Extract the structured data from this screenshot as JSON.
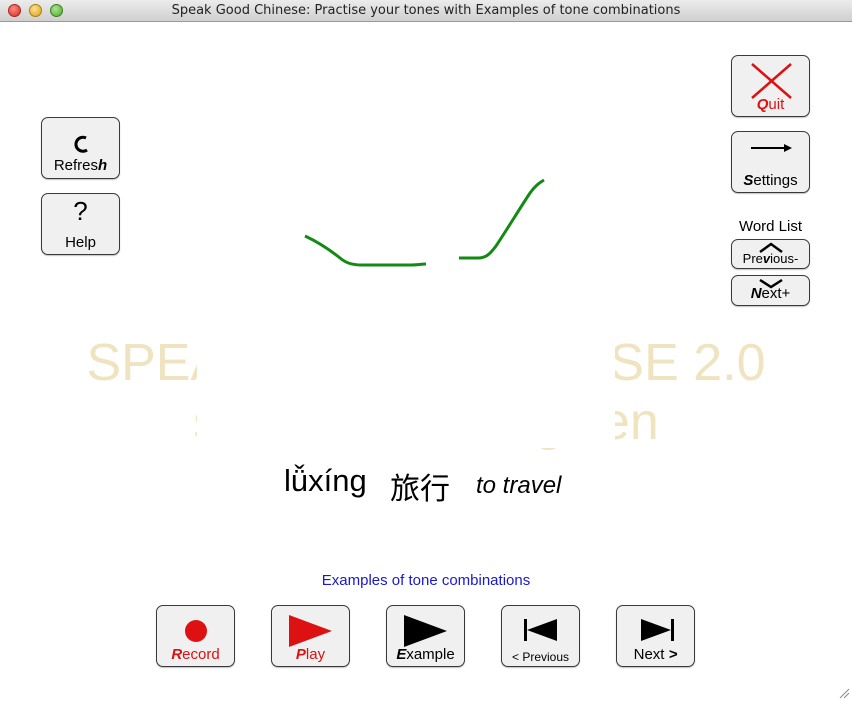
{
  "window": {
    "title": "Speak Good Chinese: Practise your tones with Examples of tone combinations"
  },
  "left_buttons": {
    "refresh": "Refresh",
    "help_symbol": "?",
    "help": "Help"
  },
  "right_buttons": {
    "quit": "Quit",
    "settings": "Settings",
    "word_list_label": "Word List",
    "previous": "Previous-",
    "next": "Next+"
  },
  "watermark": {
    "line1": "SPEAK GOOD CHINESE 2.0",
    "line2": "shuo hao zhongwen"
  },
  "word": {
    "pinyin": "lǚxíng",
    "hanzi": "旅行",
    "english": "to travel"
  },
  "section_label": "Examples of tone combinations",
  "bottom_buttons": {
    "record": "Record",
    "play": "Play",
    "example": "Example",
    "previous": "< Previous",
    "next": "Next >"
  },
  "colors": {
    "accent_red": "#dd1111",
    "tone_curve": "#138a13",
    "watermark": "#efe4bf",
    "section_label": "#1a1acc"
  }
}
